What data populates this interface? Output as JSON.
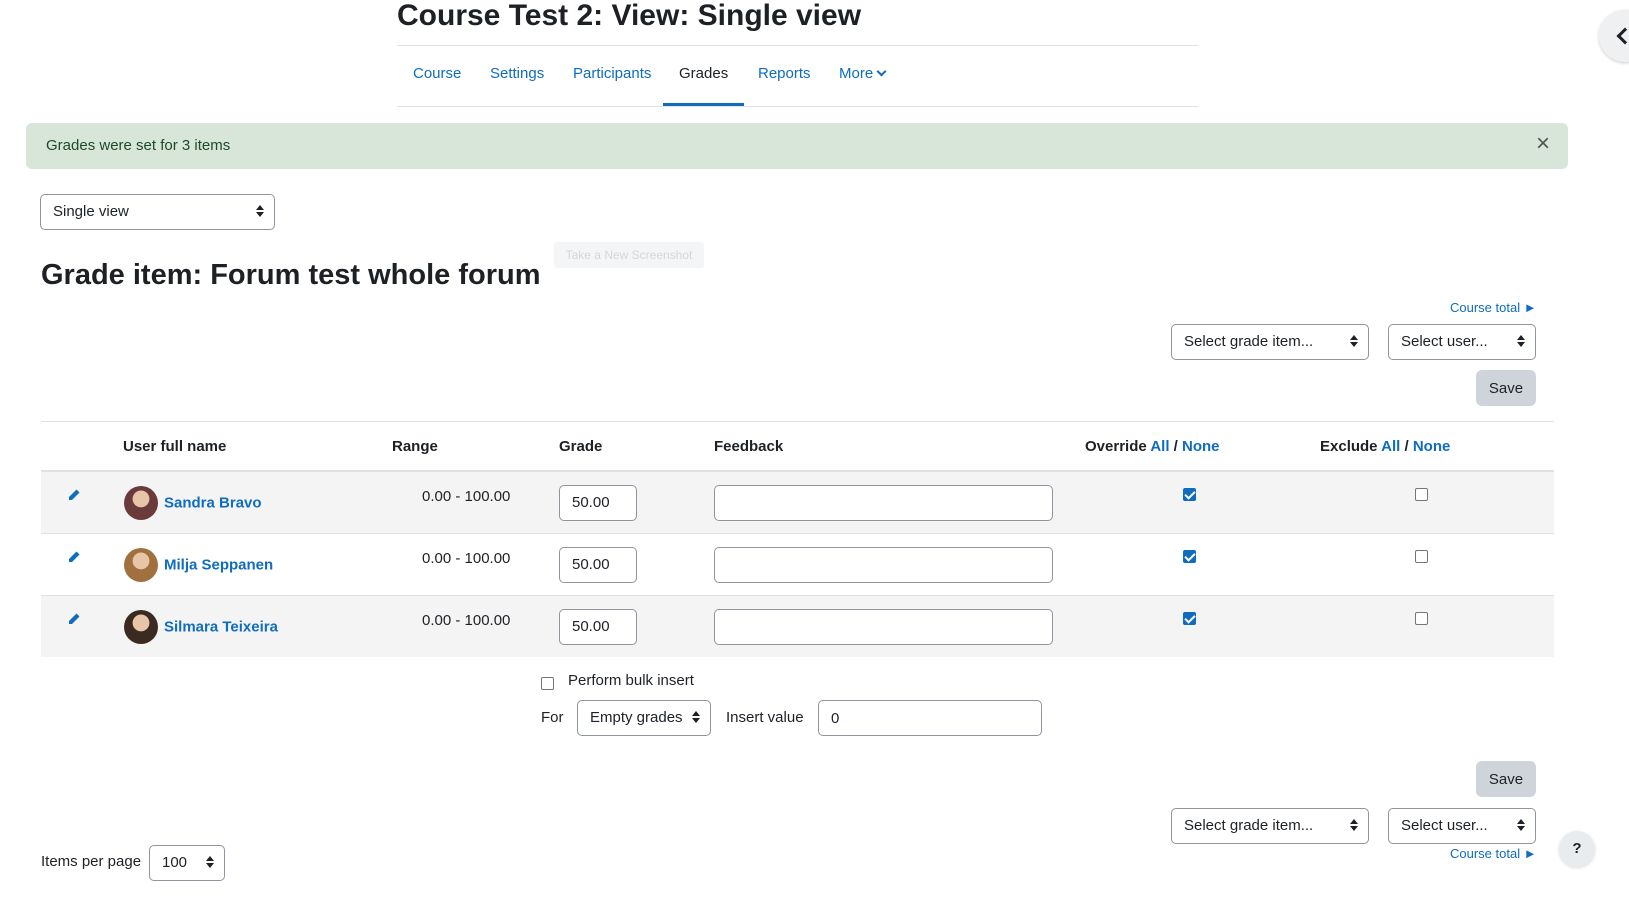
{
  "page": {
    "title": "Course Test 2: View: Single view"
  },
  "nav": {
    "tabs": [
      {
        "label": "Course"
      },
      {
        "label": "Settings"
      },
      {
        "label": "Participants"
      },
      {
        "label": "Grades",
        "active": true
      },
      {
        "label": "Reports"
      },
      {
        "label": "More"
      }
    ]
  },
  "alert": {
    "message": "Grades were set for 3 items",
    "close_symbol": "×"
  },
  "view_select": {
    "value": "Single view"
  },
  "grade_item": {
    "heading": "Grade item: Forum test whole forum"
  },
  "tooltip": {
    "text": "Take a New Screenshot"
  },
  "top_controls": {
    "course_total_link": "Course total ►",
    "grade_item_select": "Select grade item...",
    "user_select": "Select user...",
    "save_label": "Save"
  },
  "table": {
    "headers": {
      "user": "User full name",
      "range": "Range",
      "grade": "Grade",
      "feedback": "Feedback",
      "override": "Override",
      "exclude": "Exclude",
      "all": "All",
      "slash": "/",
      "none": "None"
    },
    "rows": [
      {
        "name": "Sandra Bravo",
        "range": "0.00 - 100.00",
        "grade": "50.00",
        "feedback": "",
        "override": true,
        "exclude": false,
        "avatar_color": "#6b3b3b"
      },
      {
        "name": "Milja Seppanen",
        "range": "0.00 - 100.00",
        "grade": "50.00",
        "feedback": "",
        "override": true,
        "exclude": false,
        "avatar_color": "#a0703f"
      },
      {
        "name": "Silmara Teixeira",
        "range": "0.00 - 100.00",
        "grade": "50.00",
        "feedback": "",
        "override": true,
        "exclude": false,
        "avatar_color": "#3a2a22"
      }
    ]
  },
  "bulk": {
    "label": "Perform bulk insert",
    "checked": false,
    "for_label": "For",
    "for_value": "Empty grades",
    "insert_label": "Insert value",
    "insert_value": "0"
  },
  "bottom_controls": {
    "save_label": "Save",
    "grade_item_select": "Select grade item...",
    "user_select": "Select user...",
    "course_total_link": "Course total ►"
  },
  "pagination": {
    "label": "Items per page",
    "value": "100"
  },
  "help": {
    "label": "?"
  },
  "colors": {
    "link": "#0f6cbf",
    "alert_bg": "#d7e6d9",
    "save_bg": "#ced4da"
  }
}
